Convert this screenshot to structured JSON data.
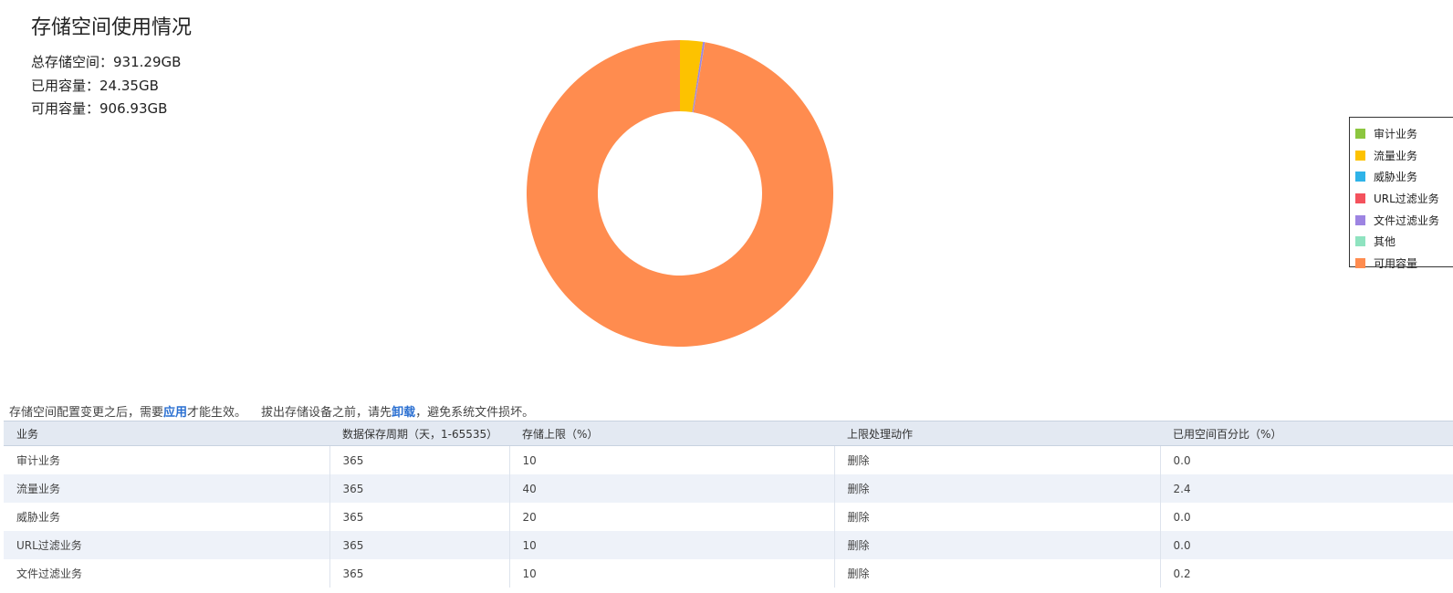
{
  "summary": {
    "title": "存储空间使用情况",
    "total": "总存储空间：931.29GB",
    "used": "已用容量：24.35GB",
    "free": "可用容量：906.93GB"
  },
  "chart_data": {
    "type": "pie",
    "donut": true,
    "legend_position": "right",
    "unit": "GB",
    "slices": [
      {
        "name": "审计业务",
        "value": 0.0,
        "color": "#8cc63f"
      },
      {
        "name": "流量业务",
        "value": 22.35,
        "color": "#fdc200"
      },
      {
        "name": "威胁业务",
        "value": 0.0,
        "color": "#2fb3e8"
      },
      {
        "name": "URL过滤业务",
        "value": 0.0,
        "color": "#f4525d"
      },
      {
        "name": "文件过滤业务",
        "value": 1.86,
        "color": "#9d84e2"
      },
      {
        "name": "其他",
        "value": 0.14,
        "color": "#8fe3c0"
      },
      {
        "name": "可用容量",
        "value": 906.93,
        "color": "#ff8c4f"
      }
    ]
  },
  "legend": [
    {
      "label": "审计业务",
      "color": "#8cc63f"
    },
    {
      "label": "流量业务",
      "color": "#fdc200"
    },
    {
      "label": "威胁业务",
      "color": "#2fb3e8"
    },
    {
      "label": "URL过滤业务",
      "color": "#f4525d"
    },
    {
      "label": "文件过滤业务",
      "color": "#9d84e2"
    },
    {
      "label": "其他",
      "color": "#8fe3c0"
    },
    {
      "label": "可用容量",
      "color": "#ff8c4f"
    }
  ],
  "note": {
    "part1": "存储空间配置变更之后，需要",
    "apply_link": "应用",
    "part2": "才能生效。",
    "part3": "拔出存储设备之前，请先",
    "unmount_link": "卸载",
    "part4": "，避免系统文件损坏。"
  },
  "table": {
    "headers": [
      "业务",
      "数据保存周期（天，1-65535）",
      "存储上限（%）",
      "上限处理动作",
      "已用空间百分比（%）"
    ],
    "rows": [
      [
        "审计业务",
        "365",
        "10",
        "删除",
        "0.0"
      ],
      [
        "流量业务",
        "365",
        "40",
        "删除",
        "2.4"
      ],
      [
        "威胁业务",
        "365",
        "20",
        "删除",
        "0.0"
      ],
      [
        "URL过滤业务",
        "365",
        "10",
        "删除",
        "0.0"
      ],
      [
        "文件过滤业务",
        "365",
        "10",
        "删除",
        "0.2"
      ]
    ]
  }
}
